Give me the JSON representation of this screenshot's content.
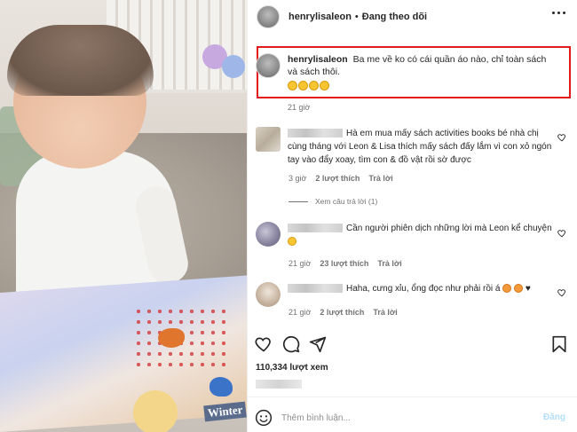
{
  "post": {
    "username": "henrylisaleon",
    "separator": "•",
    "follow_label": "Đang theo dõi",
    "photo_book_text": "Winter"
  },
  "caption": {
    "username": "henrylisaleon",
    "text": "Ba me về ko có cái quần áo nào, chỉ toàn sách và sách thôi.",
    "emoji": "rolling-on-floor-laughing x4",
    "time": "21 giờ"
  },
  "comments": [
    {
      "name_hidden": true,
      "text": "Hà em mua mấy sách activities books bé nhà chị cùng tháng với Leon & Lisa thích mấy sách đấy lắm vì con xỏ ngón tay vào đẩy xoay, tìm con & đồ vật rồi sờ được",
      "time": "3 giờ",
      "likes": "2 lượt thích",
      "reply": "Trả lời",
      "view_replies": "Xem câu trả lời (1)"
    },
    {
      "name_hidden": true,
      "text": "Cần người phiên dịch những lời mà Leon kể chuyện",
      "time": "21 giờ",
      "likes": "23 lượt thích",
      "reply": "Trả lời"
    },
    {
      "name_hidden": true,
      "text": "Haha, cưng xỉu, ổng đọc như phải rồi á",
      "time": "21 giờ",
      "likes": "2 lượt thích",
      "reply": "Trả lời"
    }
  ],
  "stats": {
    "views": "110,334 lượt xem"
  },
  "composer": {
    "placeholder": "Thêm bình luận...",
    "post_label": "Đăng"
  },
  "icons": [
    "more-horizontal-icon",
    "heart-icon",
    "comment-icon",
    "share-icon",
    "bookmark-icon",
    "emoji-icon"
  ],
  "colors": {
    "highlight_box": "#e21b1b",
    "post_button_disabled": "#b2dffc"
  }
}
